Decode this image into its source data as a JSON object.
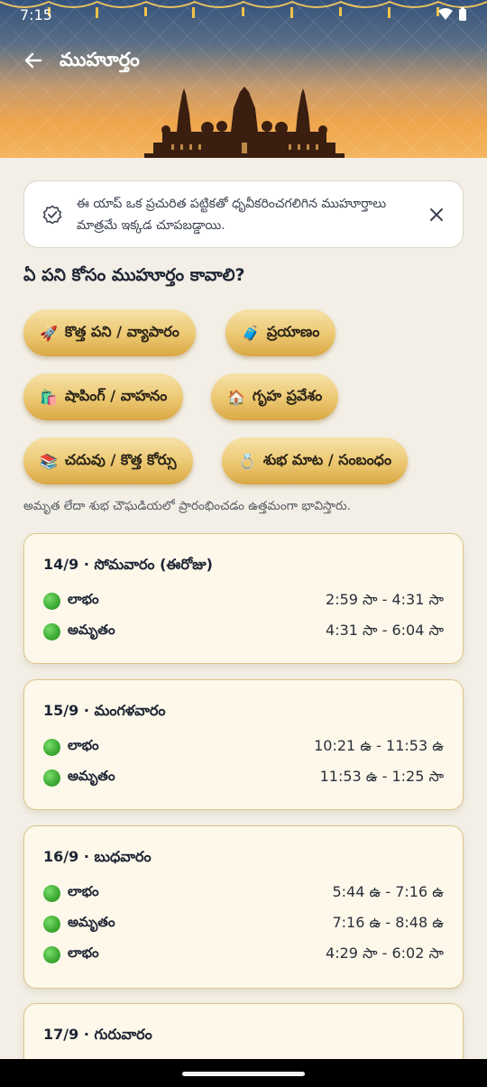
{
  "status_bar": {
    "time": "7:15"
  },
  "header": {
    "title": "ముహూర్తం"
  },
  "info_banner": {
    "text": "ఈ యాప్ ఒక ప్రచురిత పట్టికతో ధృవీకరించగలిగిన ముహూర్తాలు మాత్రమే ఇక్కడ చూపబడ్డాయి."
  },
  "question": "ఏ పని కోసం ముహూర్తం కావాలి?",
  "chips": [
    {
      "icon": "🚀",
      "label": "కొత్త పని / వ్యాపారం"
    },
    {
      "icon": "🧳",
      "label": "ప్రయాణం"
    },
    {
      "icon": "🛍️",
      "label": "షాపింగ్ / వాహనం"
    },
    {
      "icon": "🏠",
      "label": "గృహ ప్రవేశం"
    },
    {
      "icon": "📚",
      "label": "చదువు / కొత్త కోర్సు"
    },
    {
      "icon": "💍",
      "label": "శుభ మాట / సంబంధం"
    }
  ],
  "hint": "అమృత లేదా శుభ చౌఘడియలో ప్రారంభించడం ఉత్తమంగా భావిస్తారు.",
  "days": [
    {
      "title": "14/9 · సోమవారం (ఈరోజు)",
      "slots": [
        {
          "name": "లాభం",
          "time": "2:59 సా - 4:31 సా"
        },
        {
          "name": "అమృతం",
          "time": "4:31 సా - 6:04 సా"
        }
      ]
    },
    {
      "title": "15/9 · మంగళవారం",
      "slots": [
        {
          "name": "లాభం",
          "time": "10:21 ఉ - 11:53 ఉ"
        },
        {
          "name": "అమృతం",
          "time": "11:53 ఉ - 1:25 సా"
        }
      ]
    },
    {
      "title": "16/9 · బుధవారం",
      "slots": [
        {
          "name": "లాభం",
          "time": "5:44 ఉ - 7:16 ఉ"
        },
        {
          "name": "అమృతం",
          "time": "7:16 ఉ - 8:48 ఉ"
        },
        {
          "name": "లాభం",
          "time": "4:29 సా - 6:02 సా"
        }
      ]
    },
    {
      "title": "17/9 · గురువారం",
      "slots": []
    }
  ],
  "colors": {
    "accent_gold": "#e2b557",
    "good_green": "#3fae35",
    "card_bg": "#fdf8ea"
  }
}
